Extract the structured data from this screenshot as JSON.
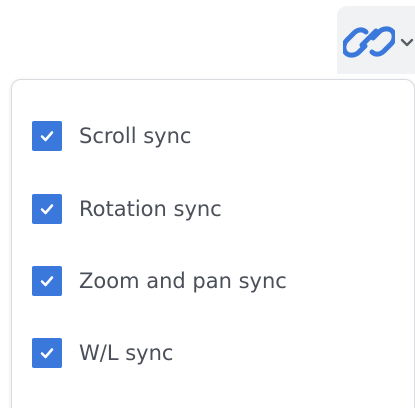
{
  "toolbar": {
    "link_icon": "link-icon",
    "chevron_icon": "chevron-down-icon"
  },
  "dropdown": {
    "items": [
      {
        "label": "Scroll sync",
        "checked": true
      },
      {
        "label": "Rotation sync",
        "checked": true
      },
      {
        "label": "Zoom and pan sync",
        "checked": true
      },
      {
        "label": "W/L sync",
        "checked": true
      }
    ]
  },
  "colors": {
    "accent": "#3b78db",
    "text": "#4a4f59",
    "panel_border": "#d8dbe0",
    "trigger_bg": "#f1f2f4"
  }
}
